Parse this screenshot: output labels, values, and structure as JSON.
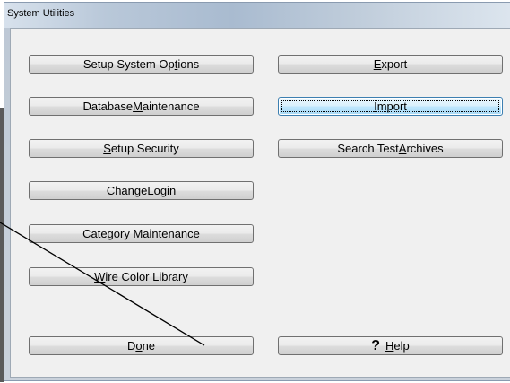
{
  "window": {
    "title": "System Utilities"
  },
  "left_buttons": [
    {
      "pre": "Setup System Op",
      "u": "t",
      "post": "ions"
    },
    {
      "pre": "Database ",
      "u": "M",
      "post": "aintenance"
    },
    {
      "pre": "",
      "u": "S",
      "post": "etup Security"
    },
    {
      "pre": "Change ",
      "u": "L",
      "post": "ogin"
    },
    {
      "pre": "",
      "u": "C",
      "post": "ategory Maintenance"
    },
    {
      "pre": "",
      "u": "W",
      "post": "ire Color Library"
    }
  ],
  "right_buttons": [
    {
      "pre": "",
      "u": "E",
      "post": "xport"
    },
    {
      "pre": "",
      "u": "I",
      "post": "mport"
    },
    {
      "pre": "Search Test ",
      "u": "A",
      "post": "rchives"
    }
  ],
  "done_button": {
    "pre": "D",
    "u": "o",
    "post": "ne"
  },
  "help_button": {
    "glyph": "?",
    "pre": "",
    "u": "H",
    "post": "elp"
  }
}
